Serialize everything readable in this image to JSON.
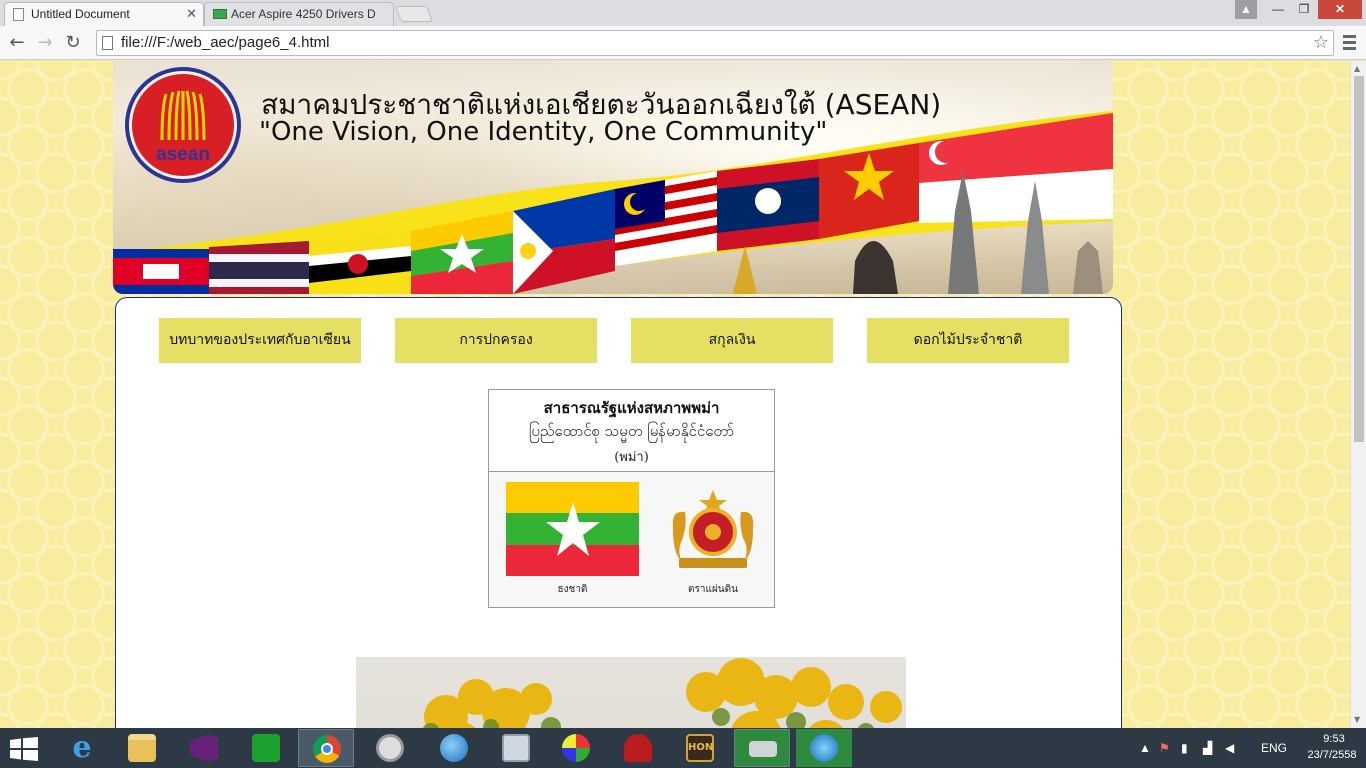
{
  "browser": {
    "tabs": [
      {
        "label": "Untitled Document"
      },
      {
        "label": "Acer Aspire 4250 Drivers D"
      }
    ],
    "url": "file:///F:/web_aec/page6_4.html"
  },
  "banner": {
    "title_th": "สมาคมประชาชาติแห่งเอเชียตะวันออกเฉียงใต้ (ASEAN)",
    "title_en": "\"One Vision, One Identity, One Community\"",
    "logo_text": "asean"
  },
  "menu": [
    {
      "label": "บทบาทของประเทศกับอาเซียน"
    },
    {
      "label": "การปกครอง"
    },
    {
      "label": "สกุลเงิน"
    },
    {
      "label": "ดอกไม้ประจำชาติ"
    }
  ],
  "country": {
    "name_th": "สาธารณรัฐแห่งสหภาพพม่า",
    "name_local": "ပြည်ထောင်စု သမ္မတ မြန်မာနိုင်ငံတော်",
    "language": "(พม่า)",
    "flag_caption": "ธงชาติ",
    "emblem_caption": "ตราแผ่นดิน",
    "flag_colors": [
      "#fecb00",
      "#34b233",
      "#ea2839"
    ]
  },
  "taskbar": {
    "language": "ENG",
    "time": "9:53",
    "date": "23/7/2558"
  }
}
